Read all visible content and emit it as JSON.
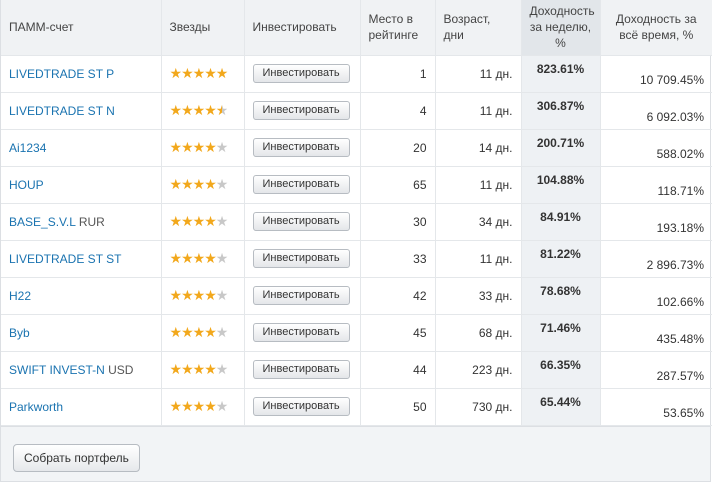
{
  "table": {
    "headers": {
      "account": "ПАММ-счет",
      "stars": "Звезды",
      "invest": "Инвестировать",
      "rank": "Место в рейтинге",
      "age": "Возраст, дни",
      "weekly": "Доходность за неделю, %",
      "total": "Доходность за всё время, %"
    },
    "invest_label": "Инвестировать",
    "rows": [
      {
        "name": "LIVEDTRADE ST P",
        "suffix": "",
        "rating": 5,
        "rank": "1",
        "age": "11 дн.",
        "weekly": "823.61%",
        "total": "10 709.45%"
      },
      {
        "name": "LIVEDTRADE ST N",
        "suffix": "",
        "rating": 4.5,
        "rank": "4",
        "age": "11 дн.",
        "weekly": "306.87%",
        "total": "6 092.03%"
      },
      {
        "name": "Ai1234",
        "suffix": "",
        "rating": 4,
        "rank": "20",
        "age": "14 дн.",
        "weekly": "200.71%",
        "total": "588.02%"
      },
      {
        "name": "HOUP",
        "suffix": "",
        "rating": 4,
        "rank": "65",
        "age": "11 дн.",
        "weekly": "104.88%",
        "total": "118.71%"
      },
      {
        "name": "BASE_S.V.L",
        "suffix": " RUR",
        "rating": 4,
        "rank": "30",
        "age": "34 дн.",
        "weekly": "84.91%",
        "total": "193.18%"
      },
      {
        "name": "LIVEDTRADE ST ST",
        "suffix": "",
        "rating": 4,
        "rank": "33",
        "age": "11 дн.",
        "weekly": "81.22%",
        "total": "2 896.73%"
      },
      {
        "name": "H22",
        "suffix": "",
        "rating": 4,
        "rank": "42",
        "age": "33 дн.",
        "weekly": "78.68%",
        "total": "102.66%"
      },
      {
        "name": "Byb",
        "suffix": "",
        "rating": 4,
        "rank": "45",
        "age": "68 дн.",
        "weekly": "71.46%",
        "total": "435.48%"
      },
      {
        "name": "SWIFT INVEST-N",
        "suffix": " USD",
        "rating": 4,
        "rank": "44",
        "age": "223 дн.",
        "weekly": "66.35%",
        "total": "287.57%"
      },
      {
        "name": "Parkworth",
        "suffix": "",
        "rating": 4,
        "rank": "50",
        "age": "730 дн.",
        "weekly": "65.44%",
        "total": "53.65%"
      }
    ]
  },
  "footer": {
    "portfolio_label": "Собрать портфель"
  },
  "colors": {
    "link": "#1a73b0",
    "star": "#f2a81c",
    "star_empty": "#c8c8c8",
    "header_bg": "#f0f2f4",
    "weekly_bg": "#eef1f4"
  },
  "icons": {
    "star": "star-icon"
  }
}
